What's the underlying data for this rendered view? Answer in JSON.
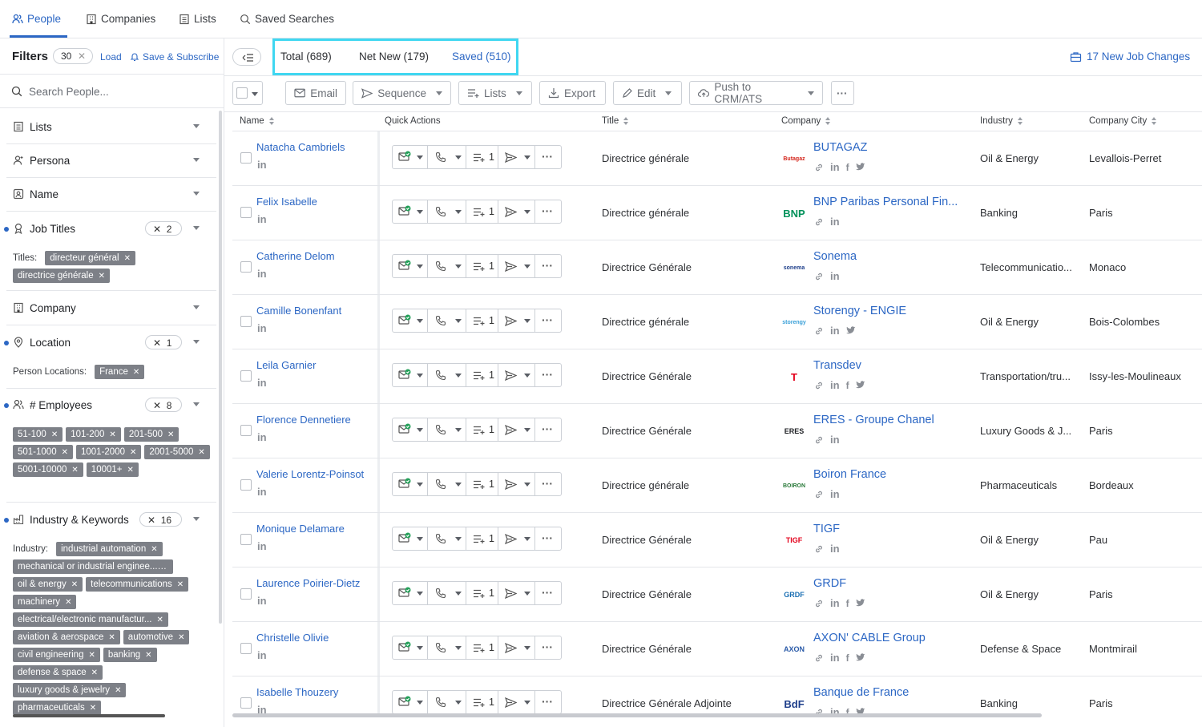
{
  "nav": {
    "tabs": [
      {
        "label": "People",
        "icon": "people-icon",
        "active": true
      },
      {
        "label": "Companies",
        "icon": "building-icon"
      },
      {
        "label": "Lists",
        "icon": "list-icon"
      },
      {
        "label": "Saved Searches",
        "icon": "saved-search-icon"
      }
    ]
  },
  "filters": {
    "title": "Filters",
    "count": "30",
    "load": "Load",
    "save_subscribe": "Save & Subscribe",
    "search_placeholder": "Search People...",
    "sections": {
      "lists": "Lists",
      "persona": "Persona",
      "name": "Name",
      "job_titles": {
        "label": "Job Titles",
        "badge": "2",
        "chips_label": "Titles:",
        "chips": [
          "directeur général",
          "directrice générale"
        ]
      },
      "company": "Company",
      "location": {
        "label": "Location",
        "badge": "1",
        "chips_label": "Person Locations:",
        "chips": [
          "France"
        ]
      },
      "employees": {
        "label": "# Employees",
        "badge": "8",
        "chips": [
          "51-100",
          "101-200",
          "201-500",
          "501-1000",
          "1001-2000",
          "2001-5000",
          "5001-10000",
          "10001+"
        ]
      },
      "industry": {
        "label": "Industry & Keywords",
        "badge": "16",
        "chips_label": "Industry:",
        "chips": [
          "industrial automation",
          "mechanical or industrial enginee...",
          "oil & energy",
          "telecommunications",
          "machinery",
          "electrical/electronic manufactur...",
          "aviation & aerospace",
          "automotive",
          "civil engineering",
          "banking",
          "defense & space",
          "luxury goods & jewelry",
          "pharmaceuticals"
        ]
      }
    }
  },
  "results": {
    "total": "Total (689)",
    "net_new": "Net New (179)",
    "saved": "Saved (510)",
    "job_changes": "17 New Job Changes"
  },
  "toolbar": {
    "email": "Email",
    "sequence": "Sequence",
    "lists": "Lists",
    "export": "Export",
    "edit": "Edit",
    "push": "Push to CRM/ATS",
    "more": "···"
  },
  "table": {
    "columns": {
      "name": "Name",
      "quick_actions": "Quick Actions",
      "title": "Title",
      "company": "Company",
      "industry": "Industry",
      "city": "Company City"
    },
    "rows": [
      {
        "name": "Natacha Cambriels",
        "title": "Directrice générale",
        "company": "BUTAGAZ",
        "logo": "Butagaz",
        "logo_color": "#d4261c",
        "socials": [
          "link",
          "in",
          "f",
          "tw"
        ],
        "industry": "Oil & Energy",
        "city": "Levallois-Perret"
      },
      {
        "name": "Felix Isabelle",
        "title": "Directrice générale",
        "company": "BNP Paribas Personal Fin...",
        "logo": "BNP",
        "logo_color": "#00915a",
        "socials": [
          "link",
          "in"
        ],
        "industry": "Banking",
        "city": "Paris"
      },
      {
        "name": "Catherine Delom",
        "title": "Directrice Générale",
        "company": "Sonema",
        "logo": "sonema",
        "logo_color": "#1d3e8a",
        "socials": [
          "link",
          "in"
        ],
        "industry": "Telecommunicatio...",
        "city": "Monaco"
      },
      {
        "name": "Camille Bonenfant",
        "title": "Directrice générale",
        "company": "Storengy - ENGIE",
        "logo": "storengy",
        "logo_color": "#3aa0d8",
        "socials": [
          "link",
          "in",
          "tw"
        ],
        "industry": "Oil & Energy",
        "city": "Bois-Colombes"
      },
      {
        "name": "Leila Garnier",
        "title": "Directrice Générale",
        "company": "Transdev",
        "logo": "T",
        "logo_color": "#e3001b",
        "socials": [
          "link",
          "in",
          "f",
          "tw"
        ],
        "industry": "Transportation/tru...",
        "city": "Issy-les-Moulineaux"
      },
      {
        "name": "Florence Dennetiere",
        "title": "Directrice Générale",
        "company": "ERES - Groupe Chanel",
        "logo": "ERES",
        "logo_color": "#1f2125",
        "socials": [
          "link",
          "in"
        ],
        "industry": "Luxury Goods & J...",
        "city": "Paris"
      },
      {
        "name": "Valerie Lorentz-Poinsot",
        "title": "Directrice générale",
        "company": "Boiron France",
        "logo": "BOIRON",
        "logo_color": "#2a7a3a",
        "socials": [
          "link",
          "in"
        ],
        "industry": "Pharmaceuticals",
        "city": "Bordeaux"
      },
      {
        "name": "Monique Delamare",
        "title": "Directrice Générale",
        "company": "TIGF",
        "logo": "TIGF",
        "logo_color": "#e3001b",
        "socials": [
          "link",
          "in"
        ],
        "industry": "Oil & Energy",
        "city": "Pau"
      },
      {
        "name": "Laurence Poirier-Dietz",
        "title": "Directrice Générale",
        "company": "GRDF",
        "logo": "GRDF",
        "logo_color": "#1a6fb3",
        "socials": [
          "link",
          "in",
          "f",
          "tw"
        ],
        "industry": "Oil & Energy",
        "city": "Paris"
      },
      {
        "name": "Christelle Olivie",
        "title": "Directrice Générale",
        "company": "AXON' CABLE Group",
        "logo": "AXON",
        "logo_color": "#2a5aa8",
        "socials": [
          "link",
          "in",
          "f",
          "tw"
        ],
        "industry": "Defense & Space",
        "city": "Montmirail"
      },
      {
        "name": "Isabelle Thouzery",
        "title": "Directrice Générale Adjointe",
        "company": "Banque de France",
        "logo": "BdF",
        "logo_color": "#1d3e8a",
        "socials": [
          "link",
          "in",
          "f",
          "tw"
        ],
        "industry": "Banking",
        "city": "Paris"
      }
    ]
  },
  "colors": {
    "accent": "#2c67c4",
    "highlight": "#3fd7f1",
    "chip": "#7d8087"
  }
}
